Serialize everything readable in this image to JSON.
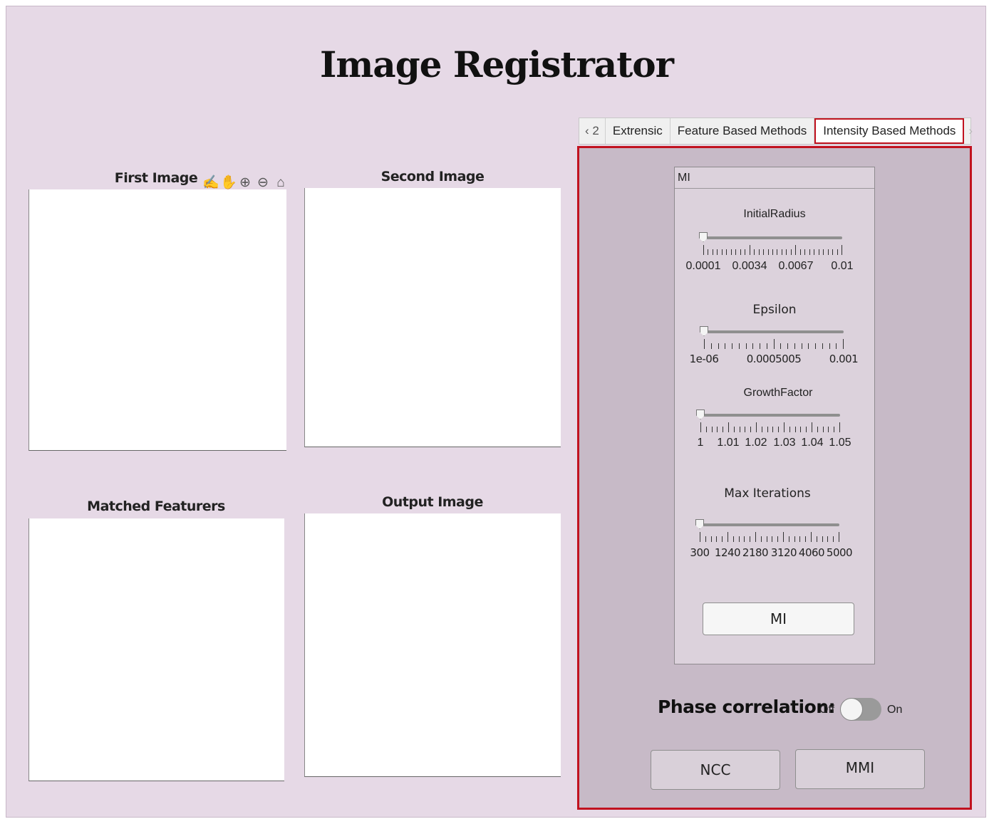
{
  "app": {
    "title": "Image Registrator"
  },
  "panels": {
    "first_image": "First Image",
    "second_image": "Second Image",
    "matched_features": "Matched Featurers",
    "output_image": "Output Image"
  },
  "axes_toolbar": {
    "icons": [
      "brush-icon",
      "pan-icon",
      "zoom-in-icon",
      "zoom-out-icon",
      "home-icon"
    ],
    "glyphs": [
      "✍",
      "✋",
      "⊕",
      "⊖",
      "⌂"
    ]
  },
  "tabs": {
    "prev": "2",
    "items": [
      "Extrensic",
      "Feature Based Methods",
      "Intensity Based Methods"
    ],
    "active": "Intensity Based Methods"
  },
  "mi_panel": {
    "title": "MI",
    "sliders": {
      "initial_radius": {
        "label": "InitialRadius",
        "ticks": [
          "0.0001",
          "0.0034",
          "0.0067",
          "0.01"
        ],
        "value": 0.0001
      },
      "epsilon": {
        "label": "Epsilon",
        "ticks": [
          "1e-06",
          "0.0005005",
          "0.001"
        ],
        "value": 1e-06
      },
      "growth_factor": {
        "label": "GrowthFactor",
        "ticks": [
          "1",
          "1.01",
          "1.02",
          "1.03",
          "1.04",
          "1.05"
        ],
        "value": 1
      },
      "max_iterations": {
        "label": "Max Iterations",
        "ticks": [
          "300",
          "1240",
          "2180",
          "3120",
          "4060",
          "5000"
        ],
        "value": 300
      }
    },
    "mi_button": "MI"
  },
  "phase_correlation": {
    "label": "Phase correlation:",
    "off": "Off",
    "on": "On",
    "state": "Off"
  },
  "buttons": {
    "ncc": "NCC",
    "mmi": "MMI"
  }
}
